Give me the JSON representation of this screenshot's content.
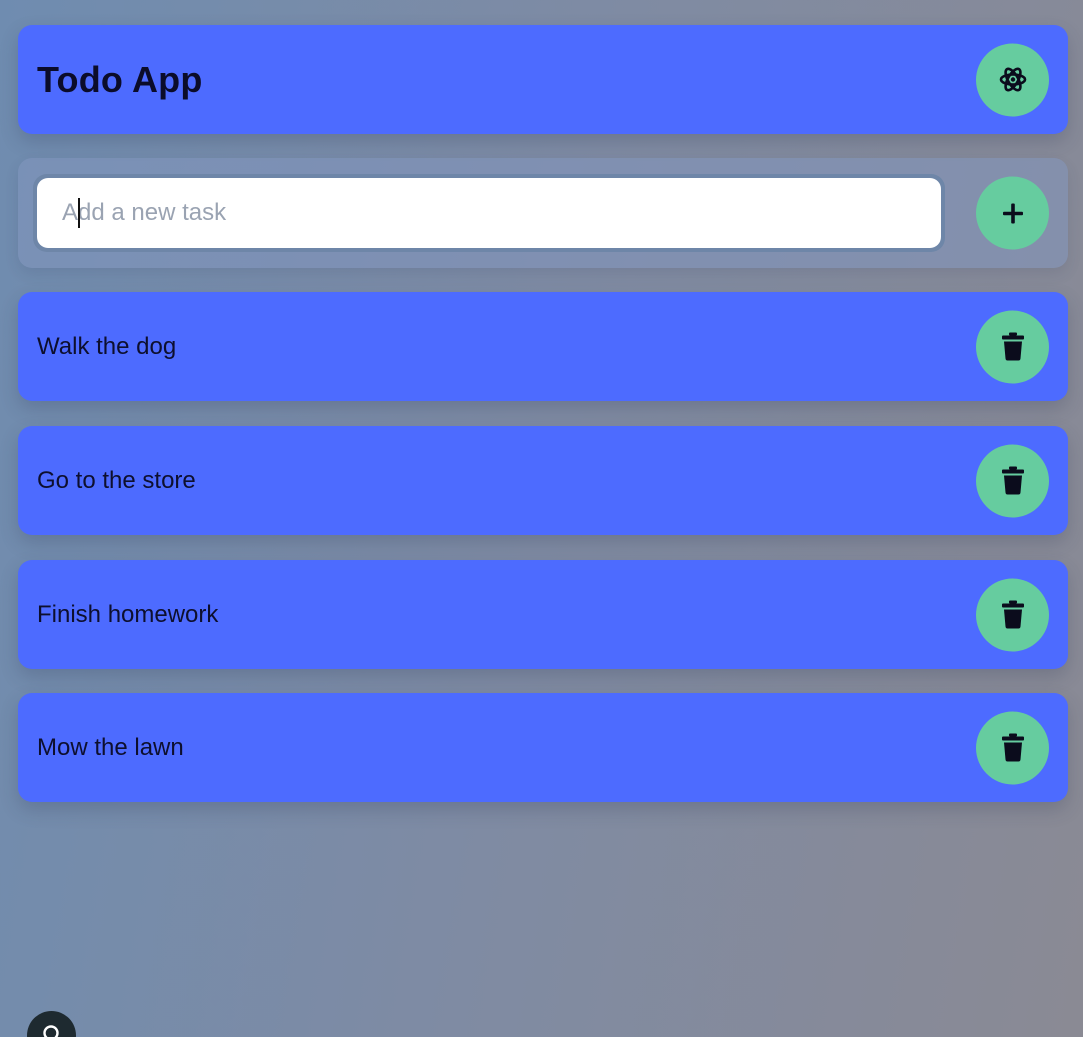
{
  "header": {
    "title": "Todo App",
    "settings_icon": "atom-icon"
  },
  "new_task": {
    "placeholder": "Add a new task",
    "value": "",
    "add_icon": "plus-icon"
  },
  "tasks": [
    {
      "label": "Walk the dog",
      "delete_icon": "trash-icon"
    },
    {
      "label": "Go to the store",
      "delete_icon": "trash-icon"
    },
    {
      "label": "Finish homework",
      "delete_icon": "trash-icon"
    },
    {
      "label": "Mow the lawn",
      "delete_icon": "trash-icon"
    }
  ],
  "colors": {
    "card": "#4d6bff",
    "button": "#66cc9f",
    "text": "#0d0f2e"
  },
  "floating_button_icon": "search-icon"
}
